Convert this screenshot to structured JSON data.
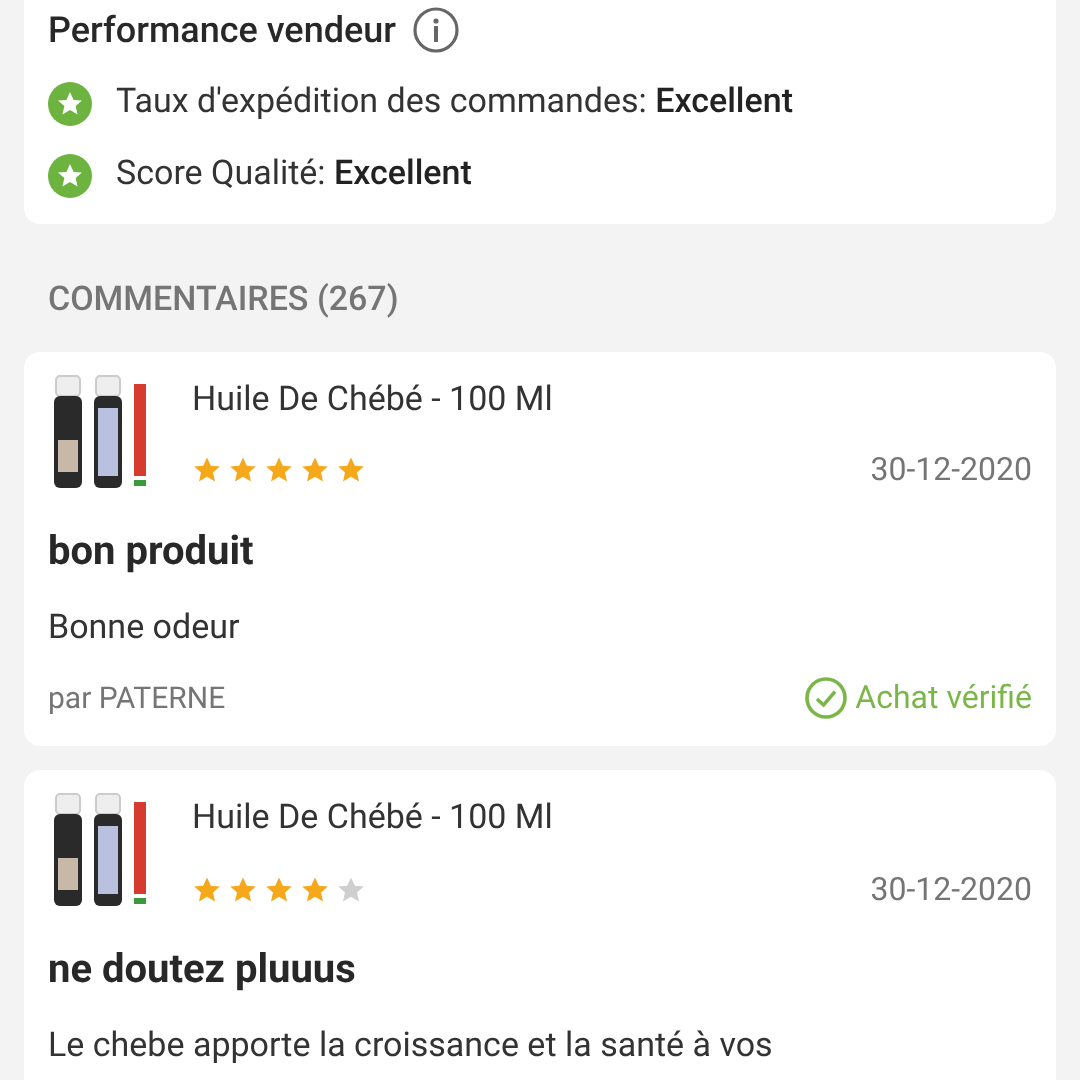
{
  "seller_performance": {
    "title": "Performance vendeur",
    "metrics": [
      {
        "label": "Taux d'expédition des commandes: ",
        "value": "Excellent"
      },
      {
        "label": "Score Qualité: ",
        "value": "Excellent"
      }
    ]
  },
  "comments": {
    "heading": "COMMENTAIRES (267)",
    "reviews": [
      {
        "product": "Huile De Chébé - 100 Ml",
        "stars": 5,
        "date": "30-12-2020",
        "title": "bon produit",
        "body": "Bonne odeur",
        "author": "par PATERNE",
        "verified": "Achat vérifié"
      },
      {
        "product": "Huile De Chébé - 100 Ml",
        "stars": 4,
        "date": "30-12-2020",
        "title": "ne doutez pluuus",
        "body": "Le chebe apporte la croissance et la santé à vos"
      }
    ]
  }
}
